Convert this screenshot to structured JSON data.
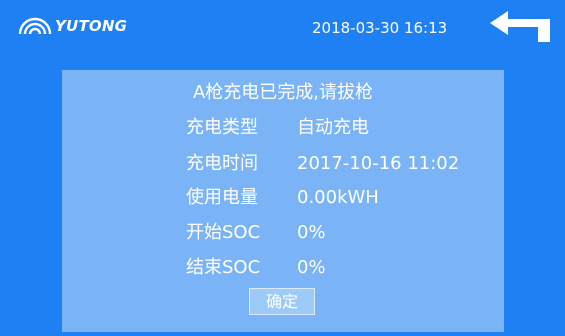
{
  "header": {
    "brand": "YUTONG",
    "datetime": "2018-03-30 16:13",
    "back_icon": "back-arrow-icon"
  },
  "dialog": {
    "title": "A枪充电已完成,请拔枪",
    "rows": [
      {
        "label": "充电类型",
        "value": "自动充电"
      },
      {
        "label": "充电时间",
        "value": "2017-10-16 11:02"
      },
      {
        "label": "使用电量",
        "value": "0.00kWH"
      },
      {
        "label": "开始SOC",
        "value": "0%"
      },
      {
        "label": "结束SOC",
        "value": "0%"
      }
    ],
    "confirm_label": "确定"
  },
  "colors": {
    "background": "#1f80f4",
    "dialog_background": "#7ab4f7",
    "text": "#ffffff"
  }
}
